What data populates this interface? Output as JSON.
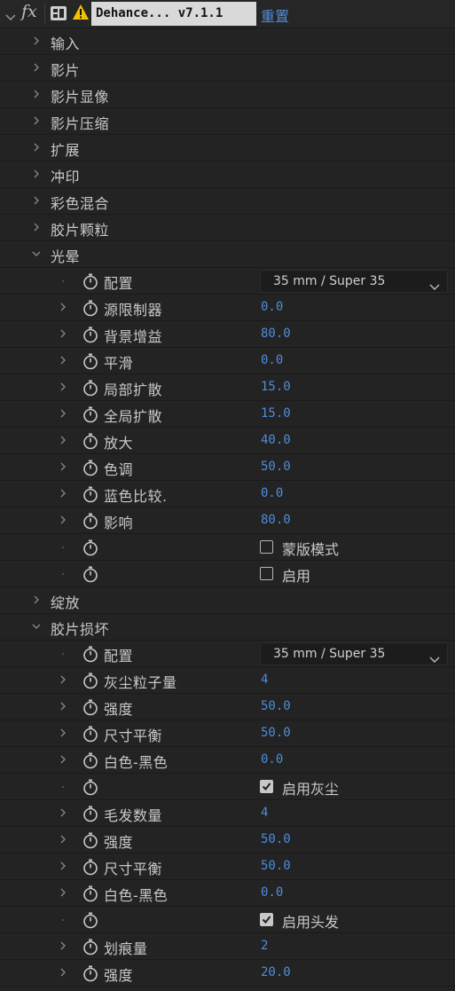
{
  "effect": {
    "fx_label": "fx",
    "name": "Dehance... v7.1.1",
    "reset_label": "重置"
  },
  "groups": {
    "input": "输入",
    "film": "影片",
    "develop": "影片显像",
    "compress": "影片压缩",
    "expand": "扩展",
    "print": "冲印",
    "color_blend": "彩色混合",
    "grain": "胶片颗粒",
    "halation": "光晕",
    "bloom": "绽放",
    "damage": "胶片损坏"
  },
  "halation": {
    "config_label": "配置",
    "config_value": "35 mm / Super 35",
    "source_limiter_label": "源限制器",
    "source_limiter_value": "0.0",
    "bg_gain_label": "背景增益",
    "bg_gain_value": "80.0",
    "smooth_label": "平滑",
    "smooth_value": "0.0",
    "local_diffuse_label": "局部扩散",
    "local_diffuse_value": "15.0",
    "global_diffuse_label": "全局扩散",
    "global_diffuse_value": "15.0",
    "magnify_label": "放大",
    "magnify_value": "40.0",
    "hue_label": "色调",
    "hue_value": "50.0",
    "blue_compare_label": "蓝色比较.",
    "blue_compare_value": "0.0",
    "influence_label": "影响",
    "influence_value": "80.0",
    "mask_mode_label": "蒙版模式",
    "mask_mode_checked": false,
    "enable_label": "启用",
    "enable_checked": false
  },
  "damage": {
    "config_label": "配置",
    "config_value": "35 mm / Super 35",
    "dust_amount_label": "灰尘粒子量",
    "dust_amount_value": "4",
    "dust_strength_label": "强度",
    "dust_strength_value": "50.0",
    "dust_size_label": "尺寸平衡",
    "dust_size_value": "50.0",
    "dust_wb_label": "白色-黑色",
    "dust_wb_value": "0.0",
    "enable_dust_label": "启用灰尘",
    "enable_dust_checked": true,
    "hair_count_label": "毛发数量",
    "hair_count_value": "4",
    "hair_strength_label": "强度",
    "hair_strength_value": "50.0",
    "hair_size_label": "尺寸平衡",
    "hair_size_value": "50.0",
    "hair_wb_label": "白色-黑色",
    "hair_wb_value": "0.0",
    "enable_hair_label": "启用头发",
    "enable_hair_checked": true,
    "scratch_amount_label": "划痕量",
    "scratch_amount_value": "2",
    "scratch_strength_label": "强度",
    "scratch_strength_value": "20.0"
  },
  "colors": {
    "value_blue": "#4e8ddb",
    "panel_bg": "#232323",
    "warning_yellow": "#f2c200"
  }
}
